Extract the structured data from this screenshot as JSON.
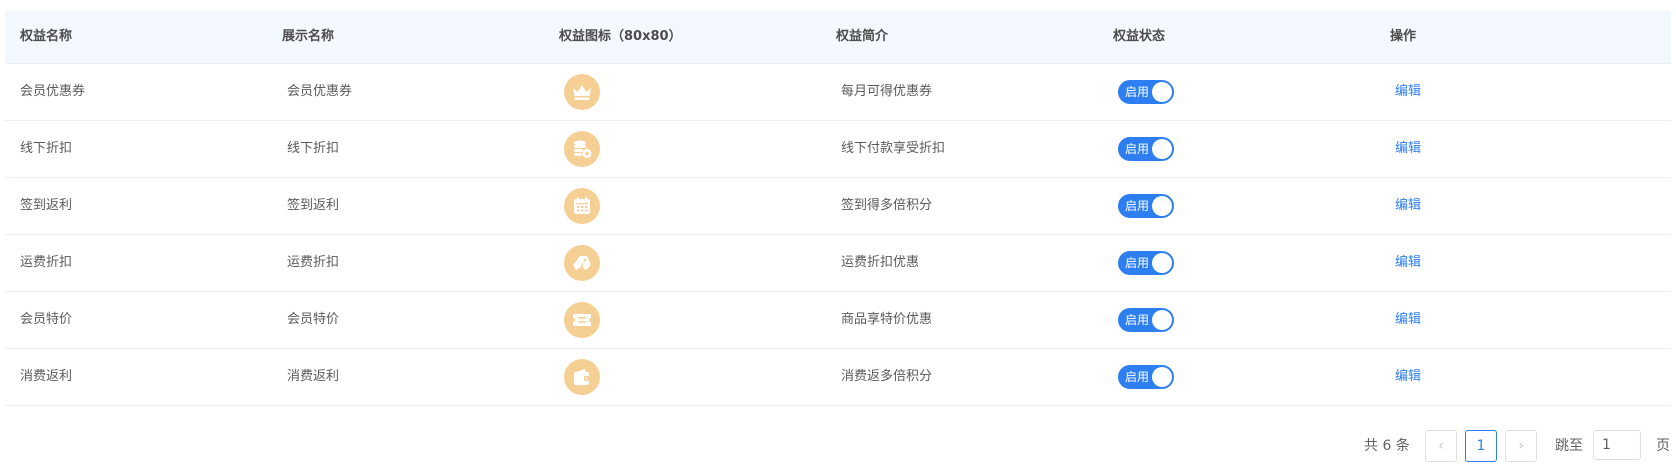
{
  "table": {
    "headers": {
      "name": "权益名称",
      "display_name": "展示名称",
      "icon": "权益图标（80x80）",
      "intro": "权益简介",
      "status": "权益状态",
      "action": "操作"
    },
    "rows": [
      {
        "name": "会员优惠券",
        "display_name": "会员优惠券",
        "icon": "crown-icon",
        "intro": "每月可得优惠券",
        "status_label": "启用",
        "action_label": "编辑"
      },
      {
        "name": "线下折扣",
        "display_name": "线下折扣",
        "icon": "coins-gear-icon",
        "intro": "线下付款享受折扣",
        "status_label": "启用",
        "action_label": "编辑"
      },
      {
        "name": "签到返利",
        "display_name": "签到返利",
        "icon": "calendar-icon",
        "intro": "签到得多倍积分",
        "status_label": "启用",
        "action_label": "编辑"
      },
      {
        "name": "运费折扣",
        "display_name": "运费折扣",
        "icon": "tag-icon",
        "intro": "运费折扣优惠",
        "status_label": "启用",
        "action_label": "编辑"
      },
      {
        "name": "会员特价",
        "display_name": "会员特价",
        "icon": "ticket-icon",
        "intro": "商品享特价优惠",
        "status_label": "启用",
        "action_label": "编辑"
      },
      {
        "name": "消费返利",
        "display_name": "消费返利",
        "icon": "wallet-icon",
        "intro": "消费返多倍积分",
        "status_label": "启用",
        "action_label": "编辑"
      }
    ]
  },
  "pagination": {
    "total": "共 6 条",
    "prev": "‹",
    "current_page": "1",
    "next": "›",
    "jump_label": "跳至",
    "jump_value": "1",
    "page_suffix": "页"
  },
  "colors": {
    "accent": "#2d7ef0",
    "icon_bg": "#f6cf95",
    "header_bg": "#f3f8ff"
  }
}
